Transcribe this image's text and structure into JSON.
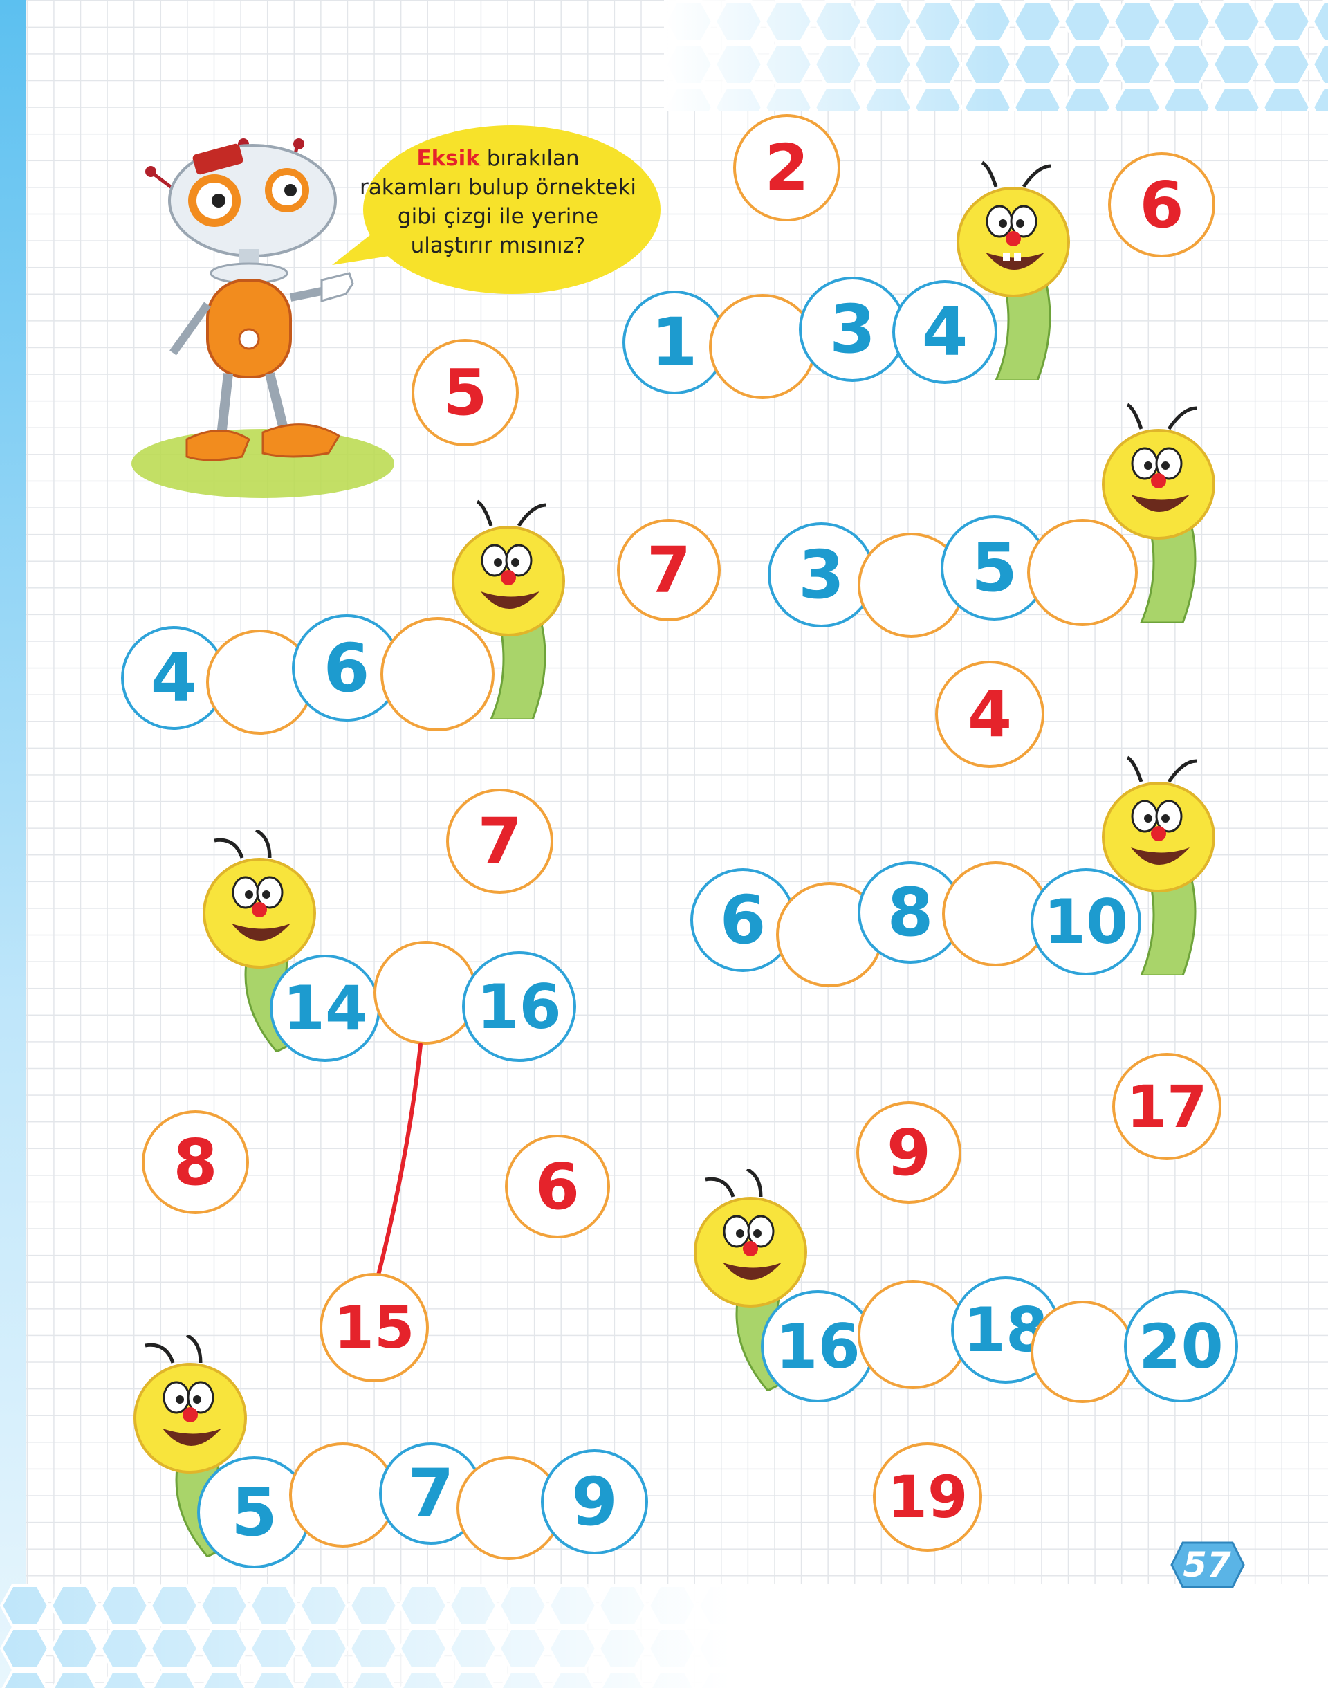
{
  "instruction": {
    "highlight": "Eksik",
    "line1_rest": " bırakılan",
    "line2": "rakamları bulup örnekteki",
    "line3": "gibi çizgi ile yerine",
    "line4": "ulaştırır mısınız?"
  },
  "colors": {
    "blue_ring": "#2ea3d9",
    "orange_ring": "#f2a23a",
    "red_digit": "#e5232b",
    "blue_digit": "#1d9bcf",
    "bubble": "#f7e22a",
    "caterpillar": "#f8e43c"
  },
  "caterpillars": {
    "c1": {
      "n1": "1",
      "n3": "3",
      "n4": "4"
    },
    "c2": {
      "n1": "3",
      "n3": "5"
    },
    "c3": {
      "n1": "4",
      "n3": "6"
    },
    "c4": {
      "n1": "6",
      "n3": "8",
      "n5": "10"
    },
    "c5": {
      "n1": "14",
      "n3": "16"
    },
    "c6": {
      "n1": "16",
      "n3": "18",
      "n5": "20"
    },
    "c7": {
      "n1": "5",
      "n3": "7",
      "n5": "9"
    }
  },
  "answers": {
    "a1": "2",
    "a2": "6",
    "a3": "5",
    "a4": "7",
    "a5": "4",
    "a6": "7",
    "a7": "8",
    "a8": "6",
    "a9": "9",
    "a10": "17",
    "a11": "15",
    "a12": "19"
  },
  "page_number": "57"
}
